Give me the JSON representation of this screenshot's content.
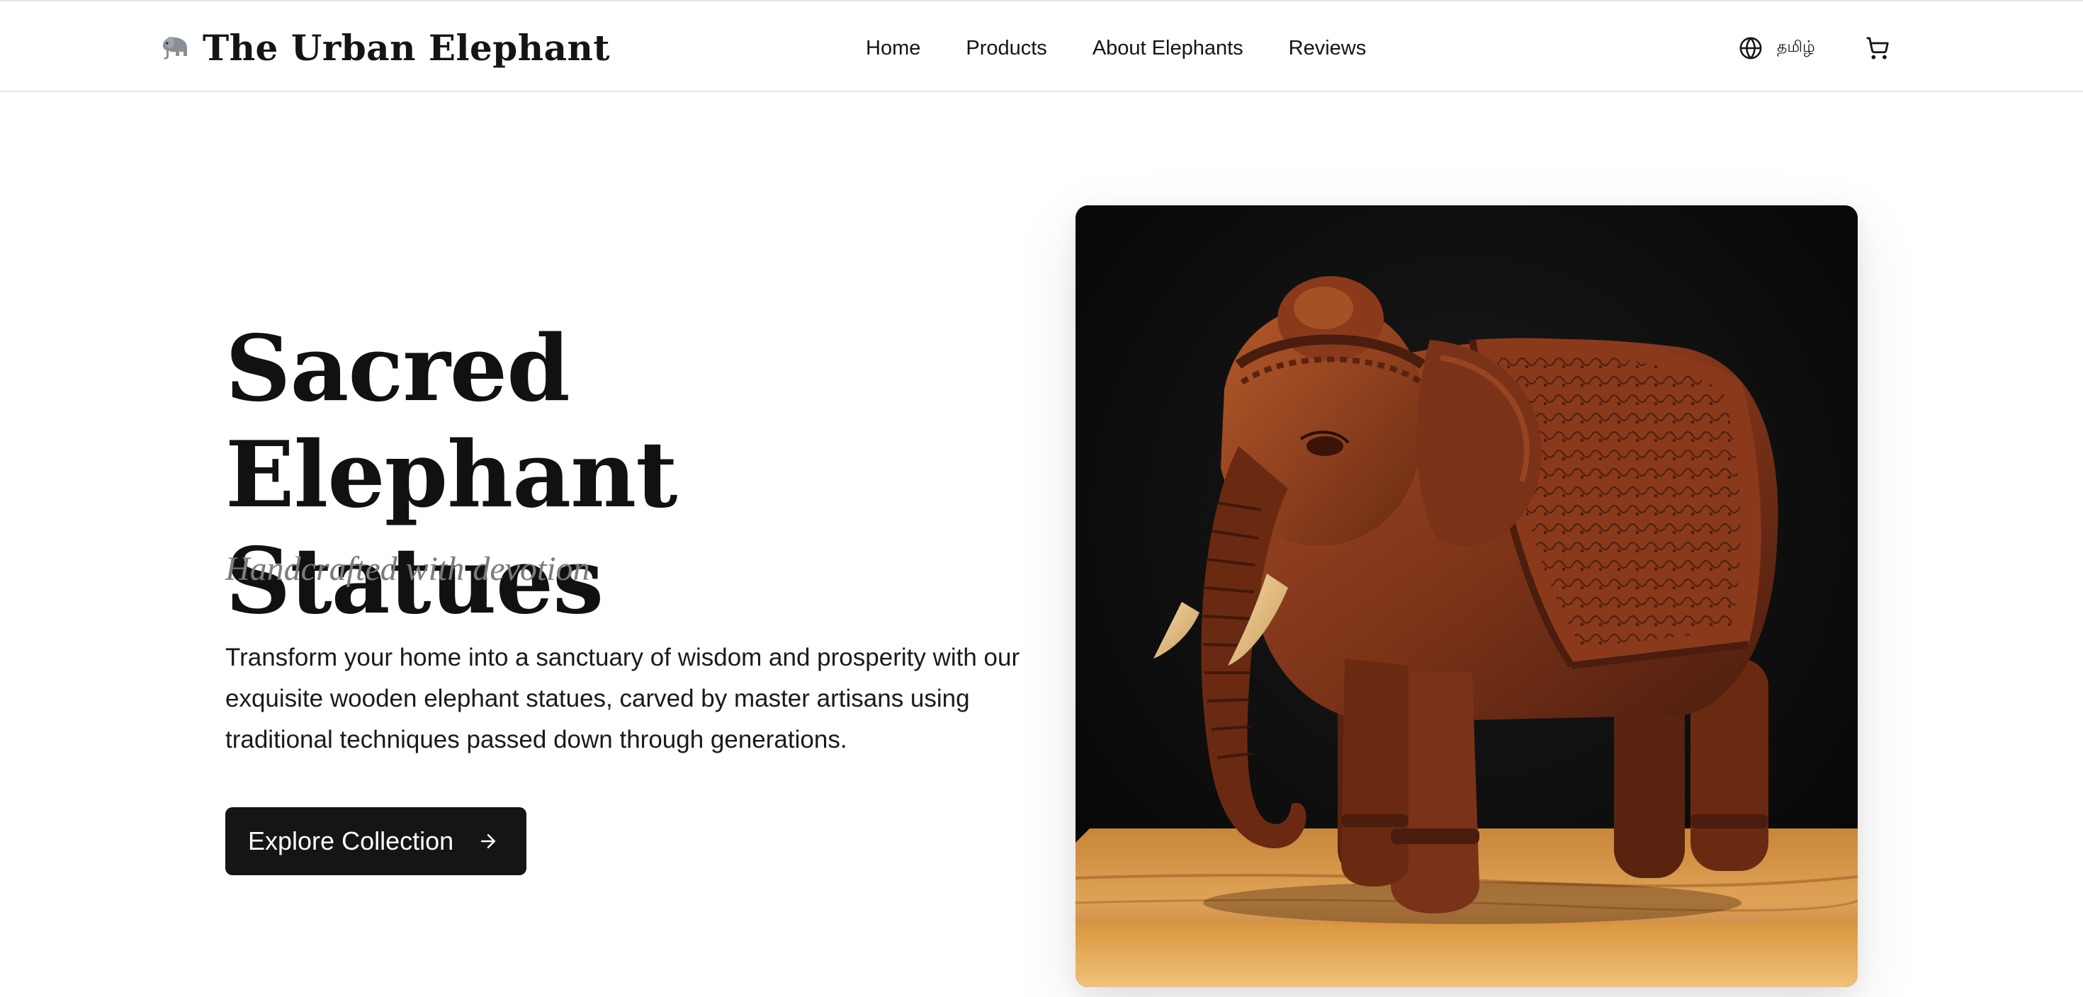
{
  "header": {
    "brand_emoji": "elephant-emoji",
    "brand_name": "The Urban Elephant",
    "nav": [
      {
        "label": "Home"
      },
      {
        "label": "Products"
      },
      {
        "label": "About Elephants"
      },
      {
        "label": "Reviews"
      }
    ],
    "language_label": "தமிழ்",
    "language_icon": "globe-icon",
    "cart_icon": "shopping-cart-icon"
  },
  "hero": {
    "title_line1": "Sacred Elephant",
    "title_line2": "Statues",
    "subtitle": "Handcrafted with devotion",
    "body": "Transform your home into a sanctuary of wisdom and prosperity with our exquisite wooden elephant statues, carved by master artisans using traditional techniques passed down through generations.",
    "cta_label": "Explore Collection",
    "cta_icon": "arrow-right-icon"
  },
  "product_image": {
    "subject": "wooden-elephant-statue",
    "colors": {
      "background": "#0b0b0b",
      "wood_dark": "#4a1d0e",
      "wood_mid": "#7a3218",
      "wood_light": "#a44c24",
      "tusk": "#e8c48a",
      "base": "#c98a3c"
    }
  }
}
